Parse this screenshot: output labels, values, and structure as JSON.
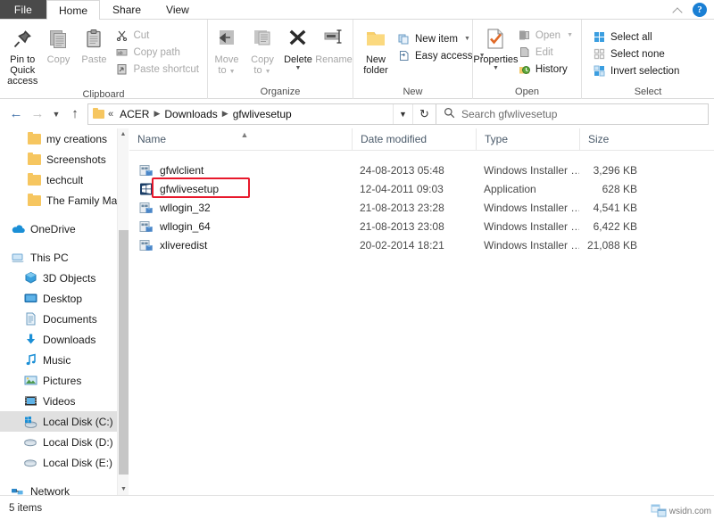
{
  "window": {
    "title": "gfwlivesetup",
    "ribbon_collapse_icon": "chevron-up-icon",
    "help_icon": "help-question-icon"
  },
  "tabs": [
    {
      "label": "File",
      "active": false,
      "kind": "file"
    },
    {
      "label": "Home",
      "active": true,
      "kind": "normal"
    },
    {
      "label": "Share",
      "active": false,
      "kind": "normal"
    },
    {
      "label": "View",
      "active": false,
      "kind": "normal"
    }
  ],
  "ribbon": {
    "groups": [
      {
        "name": "Clipboard",
        "label": "Clipboard",
        "big_buttons": [
          {
            "label": "Pin to Quick\naccess",
            "line1": "Pin to Quick",
            "line2": "access",
            "icon": "pin-icon",
            "dim": false
          },
          {
            "label": "Copy",
            "line1": "Copy",
            "line2": "",
            "icon": "copy-icon",
            "dim": true
          },
          {
            "label": "Paste",
            "line1": "Paste",
            "line2": "",
            "icon": "paste-icon",
            "dim": true
          }
        ],
        "small_buttons": [
          {
            "label": "Cut",
            "icon": "scissors-icon",
            "dim": true
          },
          {
            "label": "Copy path",
            "icon": "copy-path-icon",
            "dim": true
          },
          {
            "label": "Paste shortcut",
            "icon": "paste-shortcut-icon",
            "dim": true
          }
        ]
      },
      {
        "name": "Organize",
        "label": "Organize",
        "big_buttons": [
          {
            "line1": "Move",
            "line2": "to",
            "icon": "move-to-icon",
            "dim": true,
            "caret": true
          },
          {
            "line1": "Copy",
            "line2": "to",
            "icon": "copy-to-icon",
            "dim": true,
            "caret": true
          },
          {
            "line1": "Delete",
            "line2": "",
            "icon": "delete-x-icon",
            "dim": false,
            "caret": true
          },
          {
            "line1": "Rename",
            "line2": "",
            "icon": "rename-icon",
            "dim": true,
            "caret": false
          }
        ],
        "small_buttons": []
      },
      {
        "name": "New",
        "label": "New",
        "big_buttons": [
          {
            "line1": "New",
            "line2": "folder",
            "icon": "new-folder-icon",
            "dim": false,
            "caret": false
          }
        ],
        "small_buttons": [
          {
            "label": "New item",
            "icon": "new-item-icon",
            "dim": false,
            "caret": true
          },
          {
            "label": "Easy access",
            "icon": "easy-access-icon",
            "dim": false,
            "caret": true
          }
        ]
      },
      {
        "name": "Open",
        "label": "Open",
        "big_buttons": [
          {
            "line1": "Properties",
            "line2": "",
            "icon": "properties-icon",
            "dim": false,
            "caret": true
          }
        ],
        "small_buttons": [
          {
            "label": "Open",
            "icon": "open-icon",
            "dim": true,
            "caret": true
          },
          {
            "label": "Edit",
            "icon": "edit-icon",
            "dim": true,
            "caret": false
          },
          {
            "label": "History",
            "icon": "history-icon",
            "dim": false,
            "caret": false
          }
        ]
      },
      {
        "name": "Select",
        "label": "Select",
        "big_buttons": [],
        "small_buttons": [
          {
            "label": "Select all",
            "icon": "select-all-icon",
            "dim": false,
            "caret": false
          },
          {
            "label": "Select none",
            "icon": "select-none-icon",
            "dim": false,
            "caret": false
          },
          {
            "label": "Invert selection",
            "icon": "invert-selection-icon",
            "dim": false,
            "caret": false
          }
        ]
      }
    ]
  },
  "addressbar": {
    "back_icon": "arrow-left-icon",
    "forward_icon": "arrow-right-icon",
    "recent_icon": "chevron-down-icon",
    "up_icon": "arrow-up-icon",
    "path_prefix": "«",
    "breadcrumbs": [
      "ACER",
      "Downloads",
      "gfwlivesetup"
    ],
    "separator": "›",
    "dropdown_icon": "chevron-down-icon",
    "refresh_icon": "refresh-icon",
    "search_icon": "search-icon",
    "search_placeholder": "Search gfwlivesetup",
    "search_value": ""
  },
  "sidebar": {
    "items": [
      {
        "label": "my creations",
        "icon": "folder-icon",
        "indent": 2,
        "selected": false
      },
      {
        "label": "Screenshots",
        "icon": "folder-icon",
        "indent": 2,
        "selected": false
      },
      {
        "label": "techcult",
        "icon": "folder-icon",
        "indent": 2,
        "selected": false
      },
      {
        "label": "The Family Man :",
        "icon": "folder-icon",
        "indent": 2,
        "selected": false
      },
      {
        "label": "OneDrive",
        "icon": "onedrive-cloud-icon",
        "indent": 1,
        "selected": false
      },
      {
        "label": "This PC",
        "icon": "this-pc-icon",
        "indent": 1,
        "selected": false
      },
      {
        "label": "3D Objects",
        "icon": "3d-objects-icon",
        "indent": 2,
        "selected": false
      },
      {
        "label": "Desktop",
        "icon": "desktop-icon",
        "indent": 2,
        "selected": false
      },
      {
        "label": "Documents",
        "icon": "documents-icon",
        "indent": 2,
        "selected": false
      },
      {
        "label": "Downloads",
        "icon": "downloads-icon",
        "indent": 2,
        "selected": false
      },
      {
        "label": "Music",
        "icon": "music-icon",
        "indent": 2,
        "selected": false
      },
      {
        "label": "Pictures",
        "icon": "pictures-icon",
        "indent": 2,
        "selected": false
      },
      {
        "label": "Videos",
        "icon": "videos-icon",
        "indent": 2,
        "selected": false
      },
      {
        "label": "Local Disk (C:)",
        "icon": "local-disk-windows-icon",
        "indent": 2,
        "selected": true
      },
      {
        "label": "Local Disk (D:)",
        "icon": "local-disk-icon",
        "indent": 2,
        "selected": false
      },
      {
        "label": "Local Disk (E:)",
        "icon": "local-disk-icon",
        "indent": 2,
        "selected": false
      },
      {
        "label": "Network",
        "icon": "network-icon",
        "indent": 1,
        "selected": false
      }
    ],
    "scroll_up_icon": "chevron-up-icon",
    "scroll_down_icon": "chevron-down-icon"
  },
  "filelist": {
    "columns": [
      {
        "key": "name",
        "label": "Name",
        "sorted": true,
        "sort_dir": "asc"
      },
      {
        "key": "date",
        "label": "Date modified",
        "sorted": false
      },
      {
        "key": "type",
        "label": "Type",
        "sorted": false
      },
      {
        "key": "size",
        "label": "Size",
        "sorted": false
      }
    ],
    "rows": [
      {
        "name": "gfwlclient",
        "date": "24-08-2013 05:48",
        "type": "Windows Installer …",
        "size": "3,296 KB",
        "icon": "msi-installer-icon",
        "highlighted": false
      },
      {
        "name": "gfwlivesetup",
        "date": "12-04-2011 09:03",
        "type": "Application",
        "size": "628 KB",
        "icon": "windows-app-icon",
        "highlighted": true
      },
      {
        "name": "wllogin_32",
        "date": "21-08-2013 23:28",
        "type": "Windows Installer …",
        "size": "4,541 KB",
        "icon": "msi-installer-icon",
        "highlighted": false
      },
      {
        "name": "wllogin_64",
        "date": "21-08-2013 23:08",
        "type": "Windows Installer …",
        "size": "6,422 KB",
        "icon": "msi-installer-icon",
        "highlighted": false
      },
      {
        "name": "xliveredist",
        "date": "20-02-2014 18:21",
        "type": "Windows Installer …",
        "size": "21,088 KB",
        "icon": "msi-installer-icon",
        "highlighted": false
      }
    ],
    "highlight_color": "#e8192c"
  },
  "statusbar": {
    "item_count_text": "5 items"
  },
  "watermark": {
    "text": "wsidn.com",
    "icon": "window-logo-icon"
  }
}
